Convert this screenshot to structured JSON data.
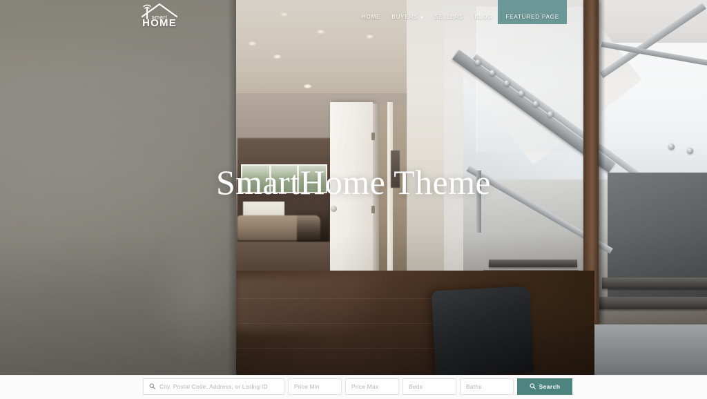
{
  "site": {
    "logo": {
      "icon": "smart-home-roof-wifi-icon",
      "brand_top": "smart",
      "brand_bottom": "HOME"
    },
    "accent_color": "#6b9896",
    "search_button_color": "#4e8480"
  },
  "nav": {
    "items": [
      {
        "label": "HOME",
        "has_dropdown": false,
        "active": false
      },
      {
        "label": "BUYERS",
        "has_dropdown": true,
        "active": false
      },
      {
        "label": "SELLERS",
        "has_dropdown": false,
        "active": false
      },
      {
        "label": "BLOG",
        "has_dropdown": false,
        "active": false
      },
      {
        "label": "FEATURED PAGE",
        "has_dropdown": false,
        "active": true
      }
    ]
  },
  "hero": {
    "title": "SmartHome Theme",
    "background_description": "Interior photo of a modern home: taupe foreground wall at left, open hallway with white door leading to a living room with sofa and windows, and a steel-and-glass staircase with dark wood newel post at right over dark hardwood floors"
  },
  "search": {
    "location": {
      "icon": "search-icon",
      "placeholder": "City, Postal Code, Address, or Listing ID",
      "value": ""
    },
    "price_min": {
      "placeholder": "Price Min",
      "value": ""
    },
    "price_max": {
      "placeholder": "Price Max",
      "value": ""
    },
    "beds": {
      "placeholder": "Beds",
      "value": ""
    },
    "baths": {
      "placeholder": "Baths",
      "value": ""
    },
    "submit": {
      "icon": "search-icon",
      "label": "Search"
    }
  }
}
